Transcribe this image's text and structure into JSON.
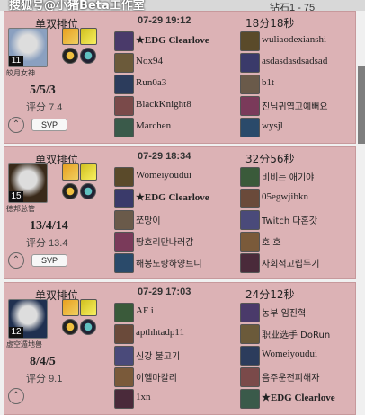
{
  "watermark": "搜狐号@小猪Beta工作室",
  "rank_header": "钻石1 - 75",
  "matches": [
    {
      "mode": "单双排位",
      "level": "11",
      "champion_name": "皎月女神",
      "kda": "5/5/3",
      "score_label": "评分",
      "score_value": "7.4",
      "badge": "SVP",
      "date": "07-29 19:12",
      "duration": "18分18秒",
      "team_left": [
        "★EDG Clearlove",
        "Nox94",
        "Run0a3",
        "BlackKnight8",
        "Marchen"
      ],
      "team_right": [
        "wuliaodexianshi",
        "asdasdasdsadsad",
        "b1t",
        "진님귀엽고예뻐요",
        "wysjl"
      ]
    },
    {
      "mode": "单双排位",
      "level": "15",
      "champion_name": "德邦总管",
      "kda": "13/4/14",
      "score_label": "评分",
      "score_value": "13.4",
      "badge": "SVP",
      "date": "07-29 18:34",
      "duration": "32分56秒",
      "team_left": [
        "Womeiyoudui",
        "★EDG Clearlove",
        "쪼망이",
        "땅호리만나러감",
        "해봉노랑하양트니"
      ],
      "team_right": [
        "비비는 애기야",
        "05egwjibkn",
        "Twitch 다혼갓",
        "호 호",
        "사회적고립두기"
      ]
    },
    {
      "mode": "单双排位",
      "level": "12",
      "champion_name": "虚空遁地兽",
      "kda": "8/4/5",
      "score_label": "评分",
      "score_value": "9.1",
      "badge": "",
      "date": "07-29 17:03",
      "duration": "24分12秒",
      "team_left": [
        "AF i",
        "apthhtadp11",
        "신강 불고기",
        "이헬마칼리",
        "1xn"
      ],
      "team_right": [
        "농부 임진혁",
        "职业选手 DoRun",
        "Womeiyoudui",
        "음주운전피해자",
        "★EDG Clearlove"
      ]
    }
  ],
  "colors": {
    "card_bg": "#dcb2b5",
    "card_border": "#c7999c",
    "page_bg": "#f0f0f0"
  },
  "icons": {
    "collapse": "chevron-up-icon"
  }
}
